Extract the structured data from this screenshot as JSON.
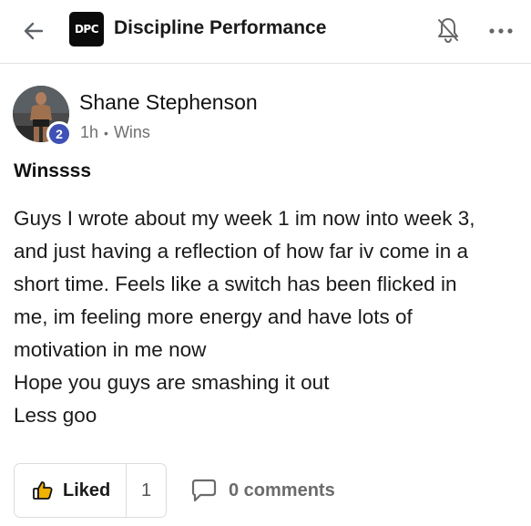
{
  "header": {
    "logo_text": "DPC",
    "group_name": "Discipline Performance",
    "icons": {
      "back": "arrow-left-icon",
      "notifications": "bell-off-icon",
      "more": "ellipsis-icon"
    }
  },
  "post": {
    "author": "Shane Stephenson",
    "level": "2",
    "time": "1h",
    "category": "Wins",
    "title": "Winssss",
    "body": [
      "Guys I wrote about my week 1 im now into week 3,",
      "and just having a reflection of how far iv come in a",
      "short time. Feels like a switch has been flicked in",
      "me, im feeling more energy and have lots of",
      "motivation in me now",
      "Hope you guys are smashing it out",
      "Less goo"
    ]
  },
  "actions": {
    "like_label": "Liked",
    "like_count": "1",
    "comments_label": "0 comments",
    "colors": {
      "level_badge": "#3f51b5",
      "like_icon": "#f0b100"
    }
  }
}
